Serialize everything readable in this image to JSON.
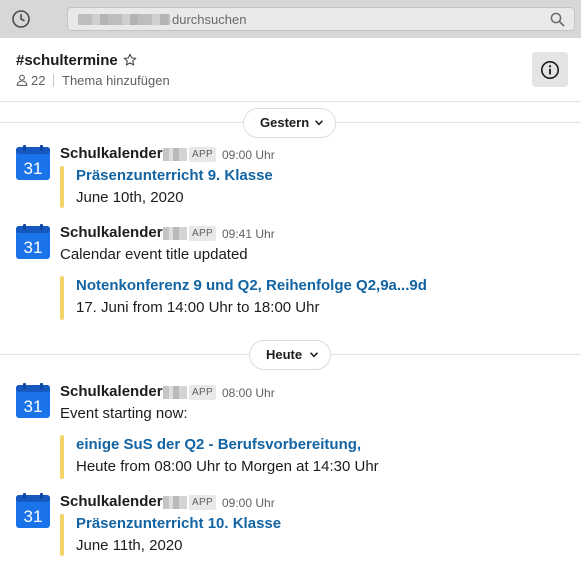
{
  "topbar": {
    "history_icon": "history-clock-icon",
    "search_placeholder": "durchsuchen",
    "search_icon": "search-icon"
  },
  "channel": {
    "name": "#schultermine",
    "member_count": "22",
    "topic_placeholder": "Thema hinzufügen",
    "star_icon": "star-outline-icon",
    "member_icon": "person-icon",
    "info_icon": "info-circle-icon"
  },
  "dividers": {
    "yesterday": "Gestern",
    "today": "Heute"
  },
  "messages": [
    {
      "sender": "Schulkalender",
      "badge": "APP",
      "time": "09:00 Uhr",
      "avatar_day": "31",
      "event_title": "Präsenzunterricht 9. Klasse",
      "event_detail": "June 10th, 2020"
    },
    {
      "sender": "Schulkalender",
      "badge": "APP",
      "time": "09:41 Uhr",
      "avatar_day": "31",
      "intro": "Calendar event title updated",
      "event_title": "Notenkonferenz 9 und Q2, Reihenfolge Q2,9a...9d",
      "event_detail": "17. Juni from 14:00 Uhr to 18:00 Uhr"
    },
    {
      "sender": "Schulkalender",
      "badge": "APP",
      "time": "08:00 Uhr",
      "avatar_day": "31",
      "intro": "Event starting now:",
      "event_title": "einige SuS der Q2 - Berufsvorbereitung,",
      "event_detail": "Heute from 08:00 Uhr to Morgen at 14:30 Uhr"
    },
    {
      "sender": "Schulkalender",
      "badge": "APP",
      "time": "09:00 Uhr",
      "avatar_day": "31",
      "event_title": "Präsenzunterricht 10. Klasse",
      "event_detail": "June 11th, 2020"
    }
  ],
  "colors": {
    "link": "#1264a3",
    "quote_bar": "#f2d468",
    "calendar_blue": "#1a73e8"
  }
}
